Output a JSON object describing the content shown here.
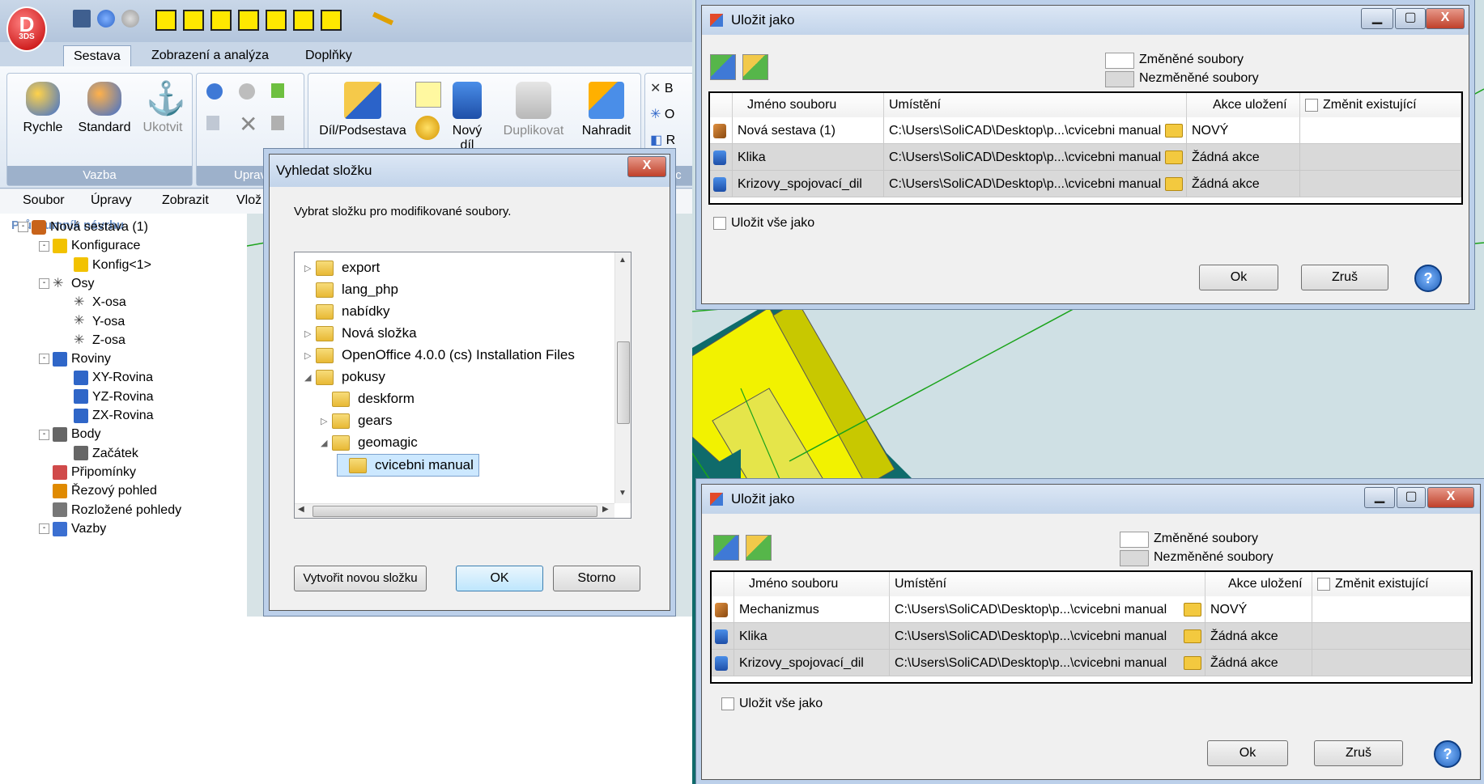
{
  "app": {
    "logo_text": "D",
    "logo_sub": "3DS",
    "ribbon_tabs": [
      "Sestava",
      "Zobrazení a analýza",
      "Doplňky"
    ],
    "ribbon_groups": {
      "vazba": {
        "label": "Vazba",
        "buttons": [
          "Rychle",
          "Standard",
          "Ukotvit"
        ]
      },
      "upravit": {
        "label": "Uprav"
      },
      "vlozit": {
        "buttons": [
          "Díl/Podsestava",
          "Nový díl",
          "Duplikovat",
          "Nahradit"
        ]
      },
      "extra": {
        "fragments": [
          "B",
          "O",
          "R",
          "Oc"
        ]
      }
    },
    "menu": [
      "Soubor",
      "Úpravy",
      "Zobrazit",
      "Vlož"
    ],
    "explorer": {
      "title": "Průzkumník návrhu",
      "tree": [
        {
          "label": "Nová sestava (1)",
          "level": 0,
          "icon": "assembly-icon",
          "pm": "-"
        },
        {
          "label": "Konfigurace",
          "level": 1,
          "icon": "config-icon",
          "pm": "-"
        },
        {
          "label": "Konfig<1>",
          "level": 2,
          "icon": "config-icon",
          "pm": ""
        },
        {
          "label": "Osy",
          "level": 1,
          "icon": "axis-icon",
          "pm": "-"
        },
        {
          "label": "X-osa",
          "level": 2,
          "icon": "axis-icon",
          "pm": ""
        },
        {
          "label": "Y-osa",
          "level": 2,
          "icon": "axis-icon",
          "pm": ""
        },
        {
          "label": "Z-osa",
          "level": 2,
          "icon": "axis-icon",
          "pm": ""
        },
        {
          "label": "Roviny",
          "level": 1,
          "icon": "plane-icon",
          "pm": "-"
        },
        {
          "label": "XY-Rovina",
          "level": 2,
          "icon": "plane-icon",
          "pm": ""
        },
        {
          "label": "YZ-Rovina",
          "level": 2,
          "icon": "plane-icon",
          "pm": ""
        },
        {
          "label": "ZX-Rovina",
          "level": 2,
          "icon": "plane-icon",
          "pm": ""
        },
        {
          "label": "Body",
          "level": 1,
          "icon": "point-icon",
          "pm": "-"
        },
        {
          "label": "Začátek",
          "level": 2,
          "icon": "point-icon",
          "pm": ""
        },
        {
          "label": "Připomínky",
          "level": 1,
          "icon": "note-icon",
          "pm": ""
        },
        {
          "label": "Řezový pohled",
          "level": 1,
          "icon": "section-icon",
          "pm": ""
        },
        {
          "label": "Rozložené pohledy",
          "level": 1,
          "icon": "explode-icon",
          "pm": ""
        },
        {
          "label": "Vazby",
          "level": 1,
          "icon": "constraint-icon",
          "pm": "-"
        }
      ]
    }
  },
  "folder_dialog": {
    "title": "Vyhledat složku",
    "instruction": "Vybrat složku pro modifikované soubory.",
    "folders": [
      {
        "label": "export",
        "level": 0,
        "expander": "▷",
        "selected": false
      },
      {
        "label": "lang_php",
        "level": 0,
        "expander": "",
        "selected": false
      },
      {
        "label": "nabídky",
        "level": 0,
        "expander": "",
        "selected": false
      },
      {
        "label": "Nová složka",
        "level": 0,
        "expander": "▷",
        "selected": false
      },
      {
        "label": "OpenOffice 4.0.0 (cs) Installation Files",
        "level": 0,
        "expander": "▷",
        "selected": false
      },
      {
        "label": "pokusy",
        "level": 0,
        "expander": "◢",
        "selected": false
      },
      {
        "label": "deskform",
        "level": 1,
        "expander": "",
        "selected": false
      },
      {
        "label": "gears",
        "level": 1,
        "expander": "▷",
        "selected": false
      },
      {
        "label": "geomagic",
        "level": 1,
        "expander": "◢",
        "selected": false
      },
      {
        "label": "cvicebni manual",
        "level": 2,
        "expander": "",
        "selected": true
      }
    ],
    "new_folder_button": "Vytvořit novou složku",
    "ok_button": "OK",
    "cancel_button": "Storno",
    "close_glyph": "X"
  },
  "save_dialog_1": {
    "title": "Uložit jako",
    "legend_changed": "Změněné soubory",
    "legend_unchanged": "Nezměněné soubory",
    "columns": [
      "Jméno souboru",
      "Umístění",
      "Akce uložení",
      "Změnit existující"
    ],
    "rows": [
      {
        "name": "Nová sestava (1)",
        "path": "C:\\Users\\SoliCAD\\Desktop\\p...\\cvicebni manual",
        "action": "NOVÝ",
        "changed": true,
        "icon": "assembly-icon"
      },
      {
        "name": "Klika",
        "path": "C:\\Users\\SoliCAD\\Desktop\\p...\\cvicebni manual",
        "action": "Žádná akce",
        "changed": false,
        "icon": "part-icon"
      },
      {
        "name": "Krizovy_spojovací_dil",
        "path": "C:\\Users\\SoliCAD\\Desktop\\p...\\cvicebni manual",
        "action": "Žádná akce",
        "changed": false,
        "icon": "part-icon"
      }
    ],
    "save_all_label": "Uložit vše jako",
    "ok_button": "Ok",
    "cancel_button": "Zruš",
    "help_glyph": "?"
  },
  "save_dialog_2": {
    "title": "Uložit jako",
    "legend_changed": "Změněné soubory",
    "legend_unchanged": "Nezměněné soubory",
    "columns": [
      "Jméno souboru",
      "Umístění",
      "Akce uložení",
      "Změnit existující"
    ],
    "rows": [
      {
        "name": "Mechanizmus",
        "path": "C:\\Users\\SoliCAD\\Desktop\\p...\\cvicebni manual",
        "action": "NOVÝ",
        "changed": true,
        "icon": "assembly-icon"
      },
      {
        "name": "Klika",
        "path": "C:\\Users\\SoliCAD\\Desktop\\p...\\cvicebni manual",
        "action": "Žádná akce",
        "changed": false,
        "icon": "part-icon"
      },
      {
        "name": "Krizovy_spojovací_dil",
        "path": "C:\\Users\\SoliCAD\\Desktop\\p...\\cvicebni manual",
        "action": "Žádná akce",
        "changed": false,
        "icon": "part-icon"
      }
    ],
    "save_all_label": "Uložit vše jako",
    "ok_button": "Ok",
    "cancel_button": "Zruš",
    "help_glyph": "?"
  },
  "colors": {
    "ribbon_accent": "#c8d6e7",
    "selection": "#cce8ff",
    "unchanged_row": "#d9d9d9",
    "model_yellow": "#f2f200",
    "model_teal": "#0f6b6b",
    "line_green": "#1aa31a"
  }
}
